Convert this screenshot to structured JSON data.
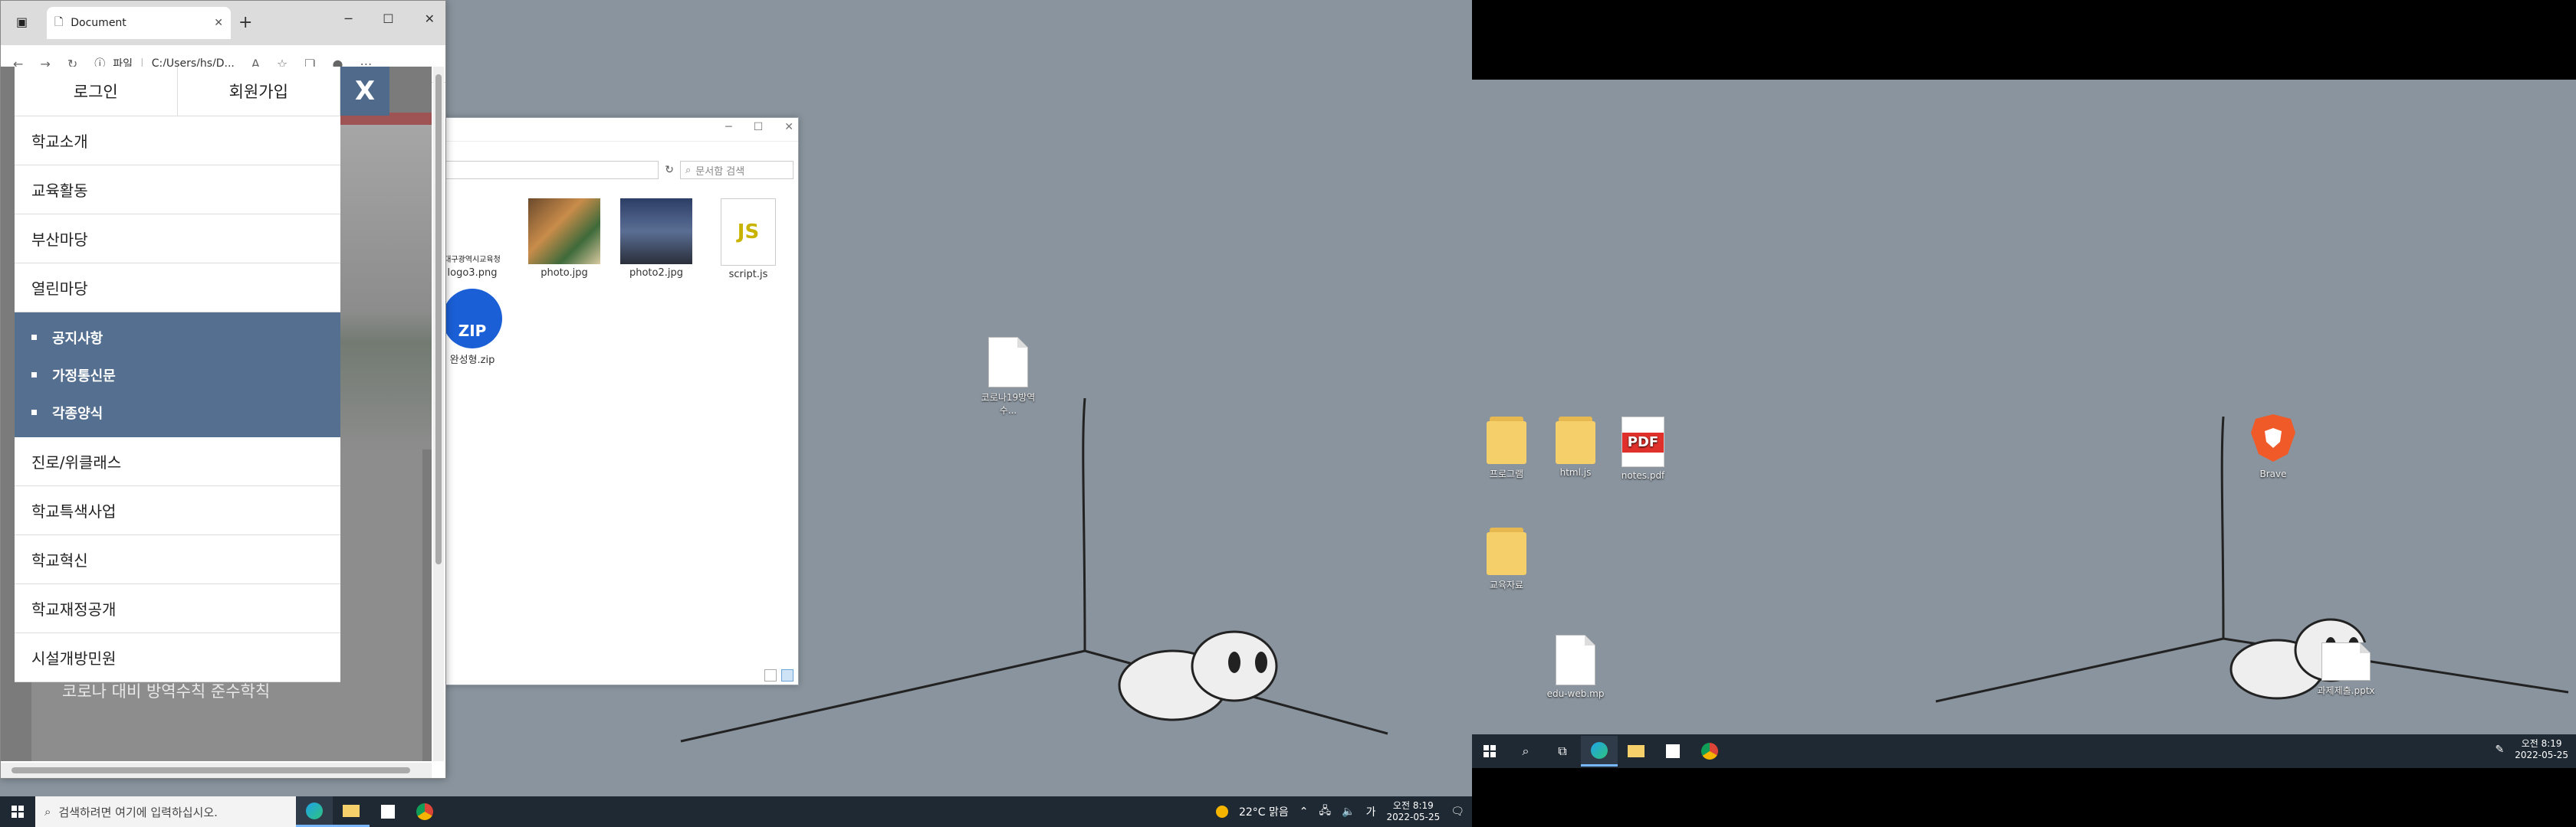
{
  "browser": {
    "tab_title": "Document",
    "address_badge": "파일",
    "url": "C:/Users/hs/D...",
    "auth": {
      "login": "로그인",
      "signup": "회원가입"
    },
    "close_label": "X",
    "menu": [
      "학교소개",
      "교육활동",
      "부산마당",
      "열린마당"
    ],
    "submenu": [
      "공지사항",
      "가정통신문",
      "각종양식"
    ],
    "menu_after": [
      "진로/위클래스",
      "학교특색사업",
      "학교혁신",
      "학교재정공개",
      "시설개방민원"
    ],
    "page_text": "코로나 대비 방역수칙 준수학칙"
  },
  "explorer": {
    "search_placeholder": "문서함 검색",
    "files": [
      {
        "name": "logo3.png",
        "caption": "대구광역시교육청"
      },
      {
        "name": "photo.jpg"
      },
      {
        "name": "photo2.jpg"
      },
      {
        "name": "script.js",
        "badge": "JS"
      },
      {
        "name": "완성형.zip",
        "badge": "ZIP"
      }
    ]
  },
  "desktop_left": {
    "doc_icon_label": "코로나19방역수..."
  },
  "desktop_right": {
    "icons": [
      {
        "label": "프로그램",
        "type": "folder"
      },
      {
        "label": "html.js",
        "type": "folder-js"
      },
      {
        "label": "notes.pdf",
        "type": "pdf",
        "badge": "PDF"
      },
      {
        "label": "교육자료",
        "type": "folder"
      },
      {
        "label": "edu-web.mp",
        "type": "edge-doc"
      },
      {
        "label": "Brave",
        "type": "brave"
      },
      {
        "label": "과제제출.pptx",
        "type": "ppt"
      }
    ]
  },
  "taskbar_left": {
    "search_placeholder": "검색하려면 여기에 입력하십시오.",
    "weather": "22°C 맑음",
    "time": "오전 8:19",
    "date": "2022-05-25",
    "ime": "가"
  },
  "taskbar_right": {
    "time": "오전 8:19",
    "date": "2022-05-25"
  }
}
